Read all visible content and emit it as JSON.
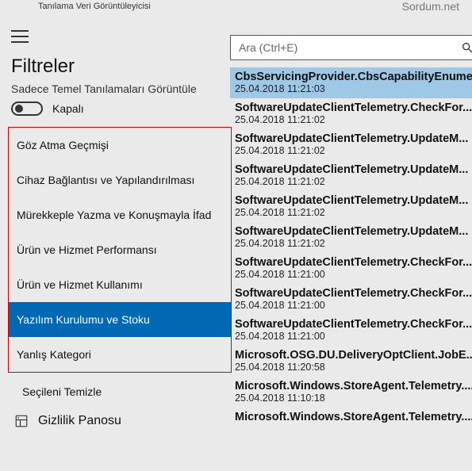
{
  "window": {
    "title": "Tanılama Veri Görüntüleyicisi",
    "brand": "Sordum.net"
  },
  "search": {
    "placeholder": "Ara (Ctrl+E)"
  },
  "filters": {
    "heading": "Filtreler",
    "subtitle": "Sadece Temel Tanılamaları Görüntüle",
    "toggle_state_label": "Kapalı",
    "items": [
      "Göz Atma Geçmişi",
      "Cihaz Bağlantısı ve Yapılandırılması",
      "Mürekkeple Yazma ve Konuşmayla İfad",
      "Ürün ve Hizmet Performansı",
      "Ürün ve Hizmet Kullanımı",
      "Yazılım Kurulumu ve Stoku",
      "Yanlış Kategori"
    ],
    "selected_index": 5,
    "clear_label": "Seçileni Temizle",
    "privacy_label": "Gizlilik Panosu"
  },
  "events": [
    {
      "title": "CbsServicingProvider.CbsCapabilityEnume...",
      "time": "25.04.2018 11:21:03",
      "selected": true
    },
    {
      "title": "SoftwareUpdateClientTelemetry.CheckFor...",
      "time": "25.04.2018 11:21:02"
    },
    {
      "title": "SoftwareUpdateClientTelemetry.UpdateM...",
      "time": "25.04.2018 11:21:02"
    },
    {
      "title": "SoftwareUpdateClientTelemetry.UpdateM...",
      "time": "25.04.2018 11:21:02"
    },
    {
      "title": "SoftwareUpdateClientTelemetry.UpdateM...",
      "time": "25.04.2018 11:21:02"
    },
    {
      "title": "SoftwareUpdateClientTelemetry.UpdateM...",
      "time": "25.04.2018 11:21:02"
    },
    {
      "title": "SoftwareUpdateClientTelemetry.CheckFor...",
      "time": "25.04.2018 11:21:00"
    },
    {
      "title": "SoftwareUpdateClientTelemetry.CheckFor...",
      "time": "25.04.2018 11:21:00"
    },
    {
      "title": "SoftwareUpdateClientTelemetry.CheckFor...",
      "time": "25.04.2018 11:21:00"
    },
    {
      "title": "Microsoft.OSG.DU.DeliveryOptClient.JobE...",
      "time": "25.04.2018 11:20:58"
    },
    {
      "title": "Microsoft.Windows.StoreAgent.Telemetry....",
      "time": "25.04.2018 11:10:18"
    },
    {
      "title": "Microsoft.Windows.StoreAgent.Telemetry....",
      "time": ""
    }
  ]
}
